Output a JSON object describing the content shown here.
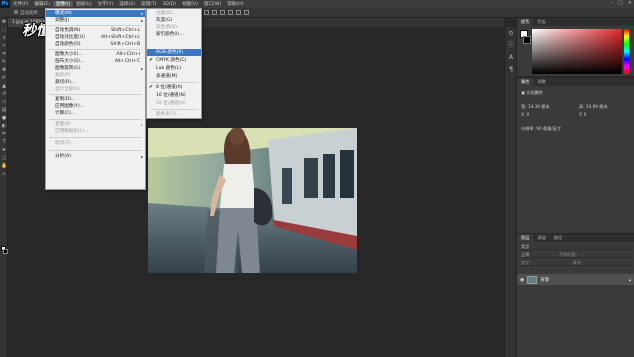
{
  "menubar": {
    "items": [
      "文件(F)",
      "编辑(E)",
      "图像(I)",
      "图层(L)",
      "文字(Y)",
      "选择(S)",
      "滤镜(T)",
      "3D(D)",
      "视图(V)",
      "窗口(W)",
      "帮助(H)"
    ],
    "window_controls": [
      "–",
      "□",
      "×"
    ]
  },
  "options_bar": {
    "auto_select": "自动选择:"
  },
  "document_tab": "1.jpg @ 100%(RGB/8#)",
  "watermark": "秒懂视频",
  "image_menu": {
    "items": [
      {
        "label": "模式(M)",
        "submenu": true,
        "highlighted": true
      },
      {
        "label": "调整(J)",
        "submenu": true
      },
      {
        "separator": true
      },
      {
        "label": "自动色调(N)",
        "shortcut": "Shift+Ctrl+L"
      },
      {
        "label": "自动对比度(U)",
        "shortcut": "Alt+Shift+Ctrl+L"
      },
      {
        "label": "自动颜色(O)",
        "shortcut": "Shift+Ctrl+B"
      },
      {
        "separator": true
      },
      {
        "label": "图像大小(I)...",
        "shortcut": "Alt+Ctrl+I"
      },
      {
        "label": "画布大小(S)...",
        "shortcut": "Alt+Ctrl+C"
      },
      {
        "label": "图像旋转(G)",
        "submenu": true
      },
      {
        "label": "裁剪(P)",
        "disabled": true
      },
      {
        "label": "裁切(R)..."
      },
      {
        "label": "显示全部(V)",
        "disabled": true
      },
      {
        "separator": true
      },
      {
        "label": "复制(D)..."
      },
      {
        "label": "应用图像(Y)..."
      },
      {
        "label": "计算(C)..."
      },
      {
        "separator": true
      },
      {
        "label": "变量(B)",
        "submenu": true,
        "disabled": true
      },
      {
        "label": "应用数据组(L)...",
        "disabled": true
      },
      {
        "separator": true
      },
      {
        "label": "陷印(T)...",
        "disabled": true
      },
      {
        "separator": true
      },
      {
        "label": "分析(A)",
        "submenu": true
      }
    ]
  },
  "mode_submenu": {
    "items": [
      {
        "label": "位图(B)...",
        "disabled": true
      },
      {
        "label": "灰度(G)"
      },
      {
        "label": "双色调(D)",
        "disabled": true
      },
      {
        "label": "索引颜色(I)..."
      },
      {
        "label": "RGB 颜色(R)",
        "highlighted": true
      },
      {
        "label": "CMYK 颜色(C)",
        "checked": true
      },
      {
        "label": "Lab 颜色(L)"
      },
      {
        "label": "多通道(M)"
      },
      {
        "separator": true
      },
      {
        "label": "8 位/通道(A)",
        "checked": true
      },
      {
        "label": "16 位/通道(N)"
      },
      {
        "label": "32 位/通道(H)",
        "disabled": true
      },
      {
        "separator": true
      },
      {
        "label": "颜色表(T)...",
        "disabled": true
      }
    ]
  },
  "color_panel": {
    "tabs": [
      "颜色",
      "色板"
    ],
    "hue_color": "#e8262a"
  },
  "properties_panel": {
    "tabs": [
      "属性",
      "调整"
    ],
    "header": "文档属性",
    "w_label": "宽:",
    "w_value": "14.39 厘米",
    "h_label": "高:",
    "h_value": "10.99 厘米",
    "x_label": "X:",
    "x_value": "0",
    "y_label": "Y:",
    "y_value": "0",
    "resolution": "分辨率: 96 像素/英寸"
  },
  "layers_panel": {
    "tabs": [
      "图层",
      "通道",
      "路径"
    ],
    "kind": "类型",
    "blend_mode": "正常",
    "opacity_label": "不透明度:",
    "lock_label": "锁定:",
    "fill_label": "填充:",
    "layer_name": "背景"
  }
}
